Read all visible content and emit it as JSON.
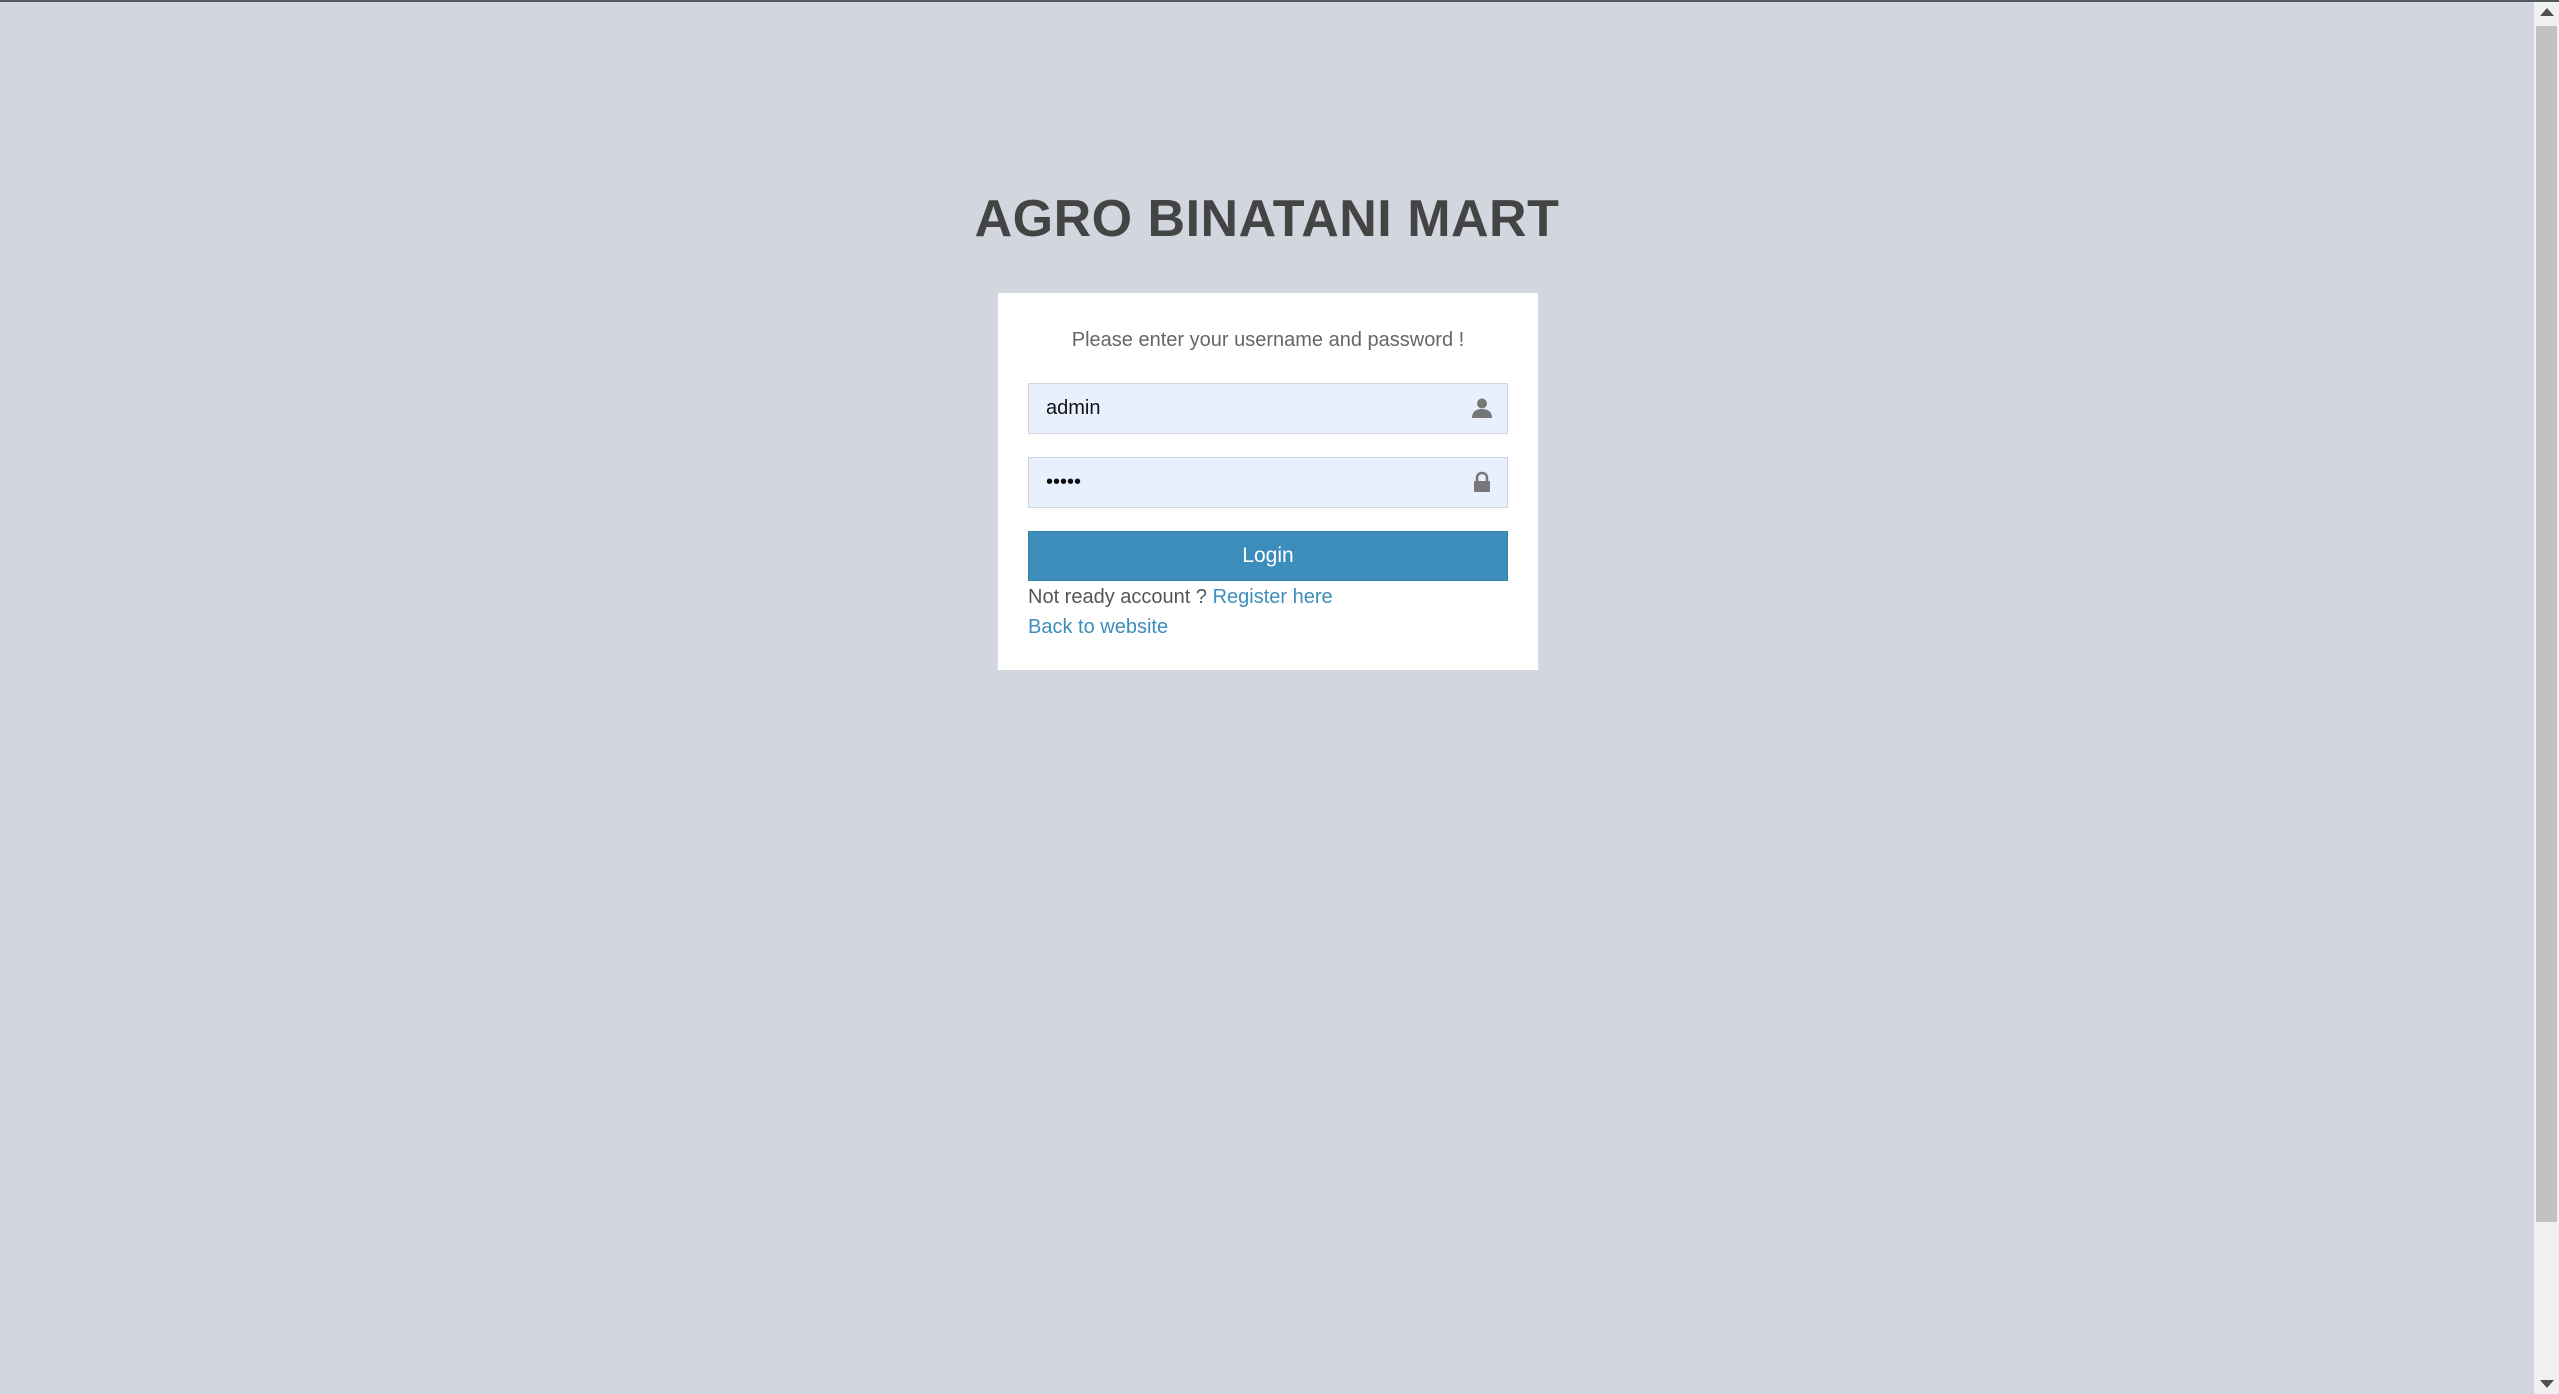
{
  "app": {
    "title": "AGRO BINATANI MART"
  },
  "login": {
    "message": "Please enter your username and password !",
    "username_value": "admin",
    "password_value": "•••••",
    "username_icon": "user-icon",
    "password_icon": "lock-icon",
    "login_label": "Login",
    "register_prompt": "Not ready account ?",
    "register_link": "Register here",
    "back_link": "Back to website"
  },
  "colors": {
    "background": "#d2d6de",
    "box": "#ffffff",
    "primary": "#3c8dbc",
    "input_autofill": "#e8f0fe",
    "title": "#444444"
  }
}
